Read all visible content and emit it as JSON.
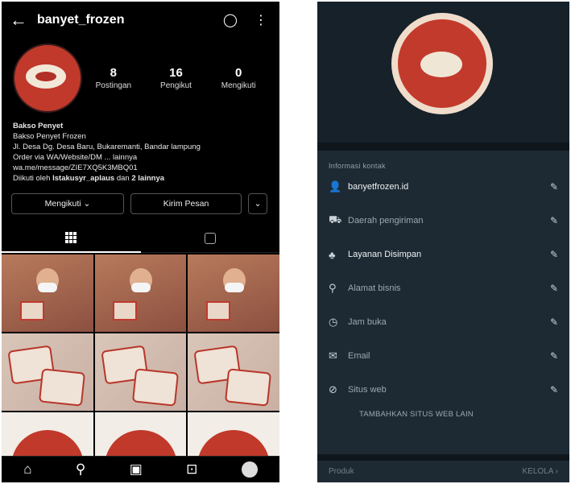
{
  "ig": {
    "username": "banyet_frozen",
    "back_icon": "←",
    "notif_icon": "◯",
    "menu_icon": "⋮",
    "stats": [
      {
        "value": "8",
        "label": "Postingan"
      },
      {
        "value": "16",
        "label": "Pengikut"
      },
      {
        "value": "0",
        "label": "Mengikuti"
      }
    ],
    "bio": {
      "name": "Bakso Penyet",
      "line1": "Bakso Penyet Frozen",
      "line2": "Jl. Desa Dg. Desa Baru, Bukaremanti, Bandar lampung",
      "line3": "Order via WA/Website/DM ... lainnya",
      "line4": "wa.me/message/ZIE7XQ5K3MBQ01",
      "mutual_prefix": "Diikuti oleh",
      "mutual_user": "lstakusyr_aplaus",
      "mutual_mid": "dan",
      "mutual_count": "2 lainnya"
    },
    "buttons": {
      "follow": "Mengikuti ⌄",
      "message": "Kirim Pesan",
      "more": "⌄"
    },
    "bottom_nav": {
      "home": "⌂",
      "search": "⚲",
      "reels": "▣",
      "shop": "⊡"
    }
  },
  "gb": {
    "section_label": "Informasi kontak",
    "rows": [
      {
        "icon": "👤",
        "text": "banyetfrozen.id",
        "strong": true
      },
      {
        "icon": "⛟",
        "text": "Daerah pengiriman",
        "strong": false
      },
      {
        "icon": "♣",
        "text": "Layanan Disimpan",
        "strong": true
      },
      {
        "icon": "⚲",
        "text": "Alamat bisnis",
        "strong": false
      },
      {
        "icon": "◷",
        "text": "Jam buka",
        "strong": false
      },
      {
        "icon": "✉",
        "text": "Email",
        "strong": false
      },
      {
        "icon": "⊘",
        "text": "Situs web",
        "strong": false
      }
    ],
    "edit_icon": "✎",
    "add_more": "TAMBAHKAN SITUS WEB LAIN",
    "footer_left": "Produk",
    "footer_right": "KELOLA ›"
  }
}
